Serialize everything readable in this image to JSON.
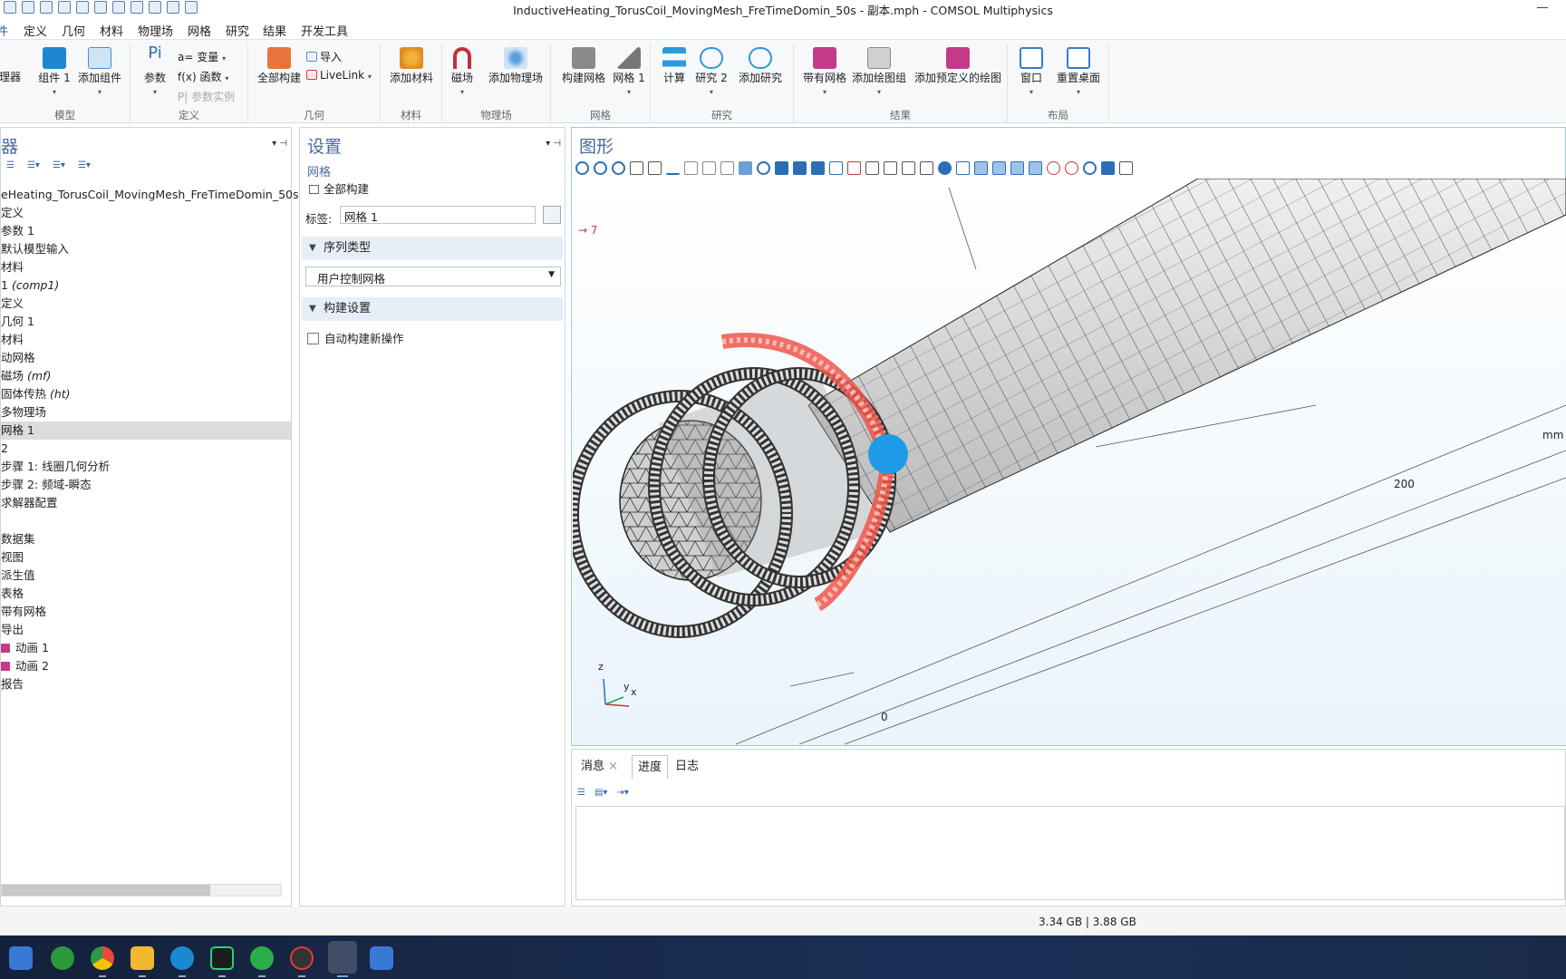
{
  "window": {
    "title": "InductiveHeating_TorusCoil_MovingMesh_FreTimeDomin_50s - 副本.mph - COMSOL Multiphysics"
  },
  "menu": [
    "文件",
    "定义",
    "几何",
    "材料",
    "物理场",
    "网格",
    "研究",
    "结果",
    "开发工具"
  ],
  "ribbon": {
    "groups": {
      "model": "模型",
      "definitions": "定义",
      "geometry": "几何",
      "materials": "材料",
      "physics": "物理场",
      "mesh": "网格",
      "study": "研究",
      "results": "结果",
      "layout": "布局"
    },
    "buttons": {
      "manager": "理器",
      "component": "组件 1",
      "add_component": "添加组件",
      "parameters": "参数",
      "variables": "a= 变量",
      "functions": "f(x) 函数",
      "param_instances": "P| 参数实例",
      "build_all": "全部构建",
      "import": "导入",
      "livelink": "LiveLink",
      "add_material": "添加材料",
      "magnetic_field": "磁场",
      "add_physics": "添加物理场",
      "build_mesh": "构建网格",
      "mesh1": "网格 1",
      "compute": "计算",
      "study2": "研究 2",
      "add_study": "添加研究",
      "with_mesh": "带有网格",
      "add_plot_group": "添加绘图组",
      "add_predefined_plot": "添加预定义的绘图",
      "windows": "窗口",
      "reset_desktop": "重置桌面"
    }
  },
  "model_builder": {
    "title": "器",
    "items": [
      {
        "label": "eHeating_TorusCoil_MovingMesh_FreTimeDomin_50s -",
        "em": ""
      },
      {
        "label": "定义",
        "em": ""
      },
      {
        "label": "参数 1",
        "em": ""
      },
      {
        "label": "默认模型输入",
        "em": ""
      },
      {
        "label": "材料",
        "em": ""
      },
      {
        "label": "1 ",
        "em": "(comp1)"
      },
      {
        "label": "定义",
        "em": ""
      },
      {
        "label": "几何 1",
        "em": ""
      },
      {
        "label": "材料",
        "em": ""
      },
      {
        "label": "动网格",
        "em": ""
      },
      {
        "label": "磁场 ",
        "em": "(mf)"
      },
      {
        "label": "固体传热 ",
        "em": "(ht)"
      },
      {
        "label": "多物理场",
        "em": ""
      },
      {
        "label": "网格 1",
        "em": ""
      },
      {
        "label": "2",
        "em": ""
      },
      {
        "label": "步骤 1: 线圈几何分析",
        "em": ""
      },
      {
        "label": "步骤 2: 频域-瞬态",
        "em": ""
      },
      {
        "label": "求解器配置",
        "em": ""
      },
      {
        "label": "",
        "em": ""
      },
      {
        "label": "数据集",
        "em": ""
      },
      {
        "label": "视图",
        "em": ""
      },
      {
        "label": "派生值",
        "em": ""
      },
      {
        "label": "表格",
        "em": ""
      },
      {
        "label": "带有网格",
        "em": ""
      },
      {
        "label": "导出",
        "em": ""
      },
      {
        "label": "动画 1",
        "em": ""
      },
      {
        "label": "动画 2",
        "em": ""
      },
      {
        "label": "报告",
        "em": ""
      }
    ],
    "selected_index": 13
  },
  "settings": {
    "title": "设置",
    "subtitle": "网格",
    "build_all": "全部构建",
    "label_caption": "标签:",
    "label_value": "网格 1",
    "section_sequence": "序列类型",
    "sequence_value": "用户控制网格",
    "section_build": "构建设置",
    "auto_build": "自动构建新操作"
  },
  "graphics": {
    "title": "图形",
    "arrow_label": "→ 7",
    "axis_unit": "mm",
    "tick_200": "200",
    "tick_0": "0",
    "axes": {
      "z": "z",
      "y": "y",
      "x": "x"
    }
  },
  "messages": {
    "tabs": [
      "消息",
      "进度",
      "日志"
    ],
    "active": 1
  },
  "status": {
    "memory": "3.34 GB | 3.88 GB"
  },
  "colors": {
    "accent": "#1e9be8",
    "coil_highlight": "#f0554a",
    "title_blue": "#4a6aa0",
    "taskbar": "#14213b"
  }
}
